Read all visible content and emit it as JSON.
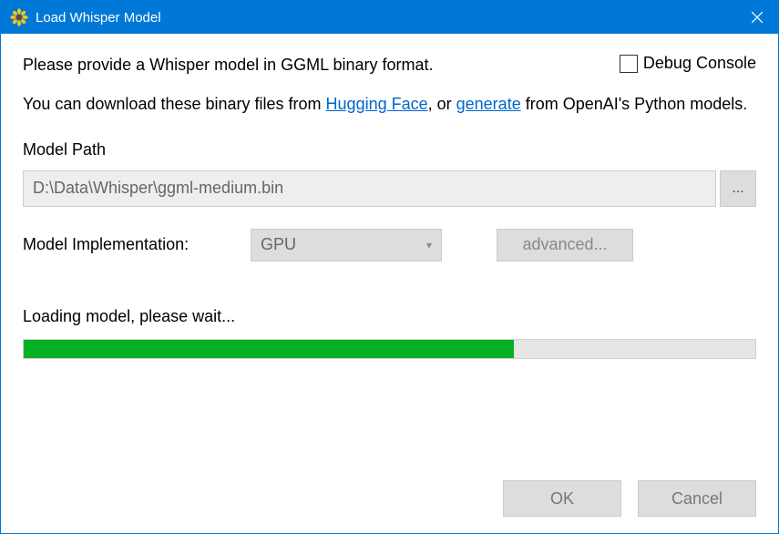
{
  "titlebar": {
    "title": "Load Whisper Model"
  },
  "intro": "Please provide a Whisper model in GGML binary format.",
  "debug_label": "Debug Console",
  "download": {
    "prefix": "You can download these binary files from ",
    "link1": "Hugging Face",
    "mid": ", or ",
    "link2": "generate",
    "suffix": " from OpenAI's Python models."
  },
  "model_path_label": "Model Path",
  "model_path_value": "D:\\Data\\Whisper\\ggml-medium.bin",
  "browse_label": "...",
  "impl_label": "Model Implementation:",
  "impl_value": "GPU",
  "advanced_label": "advanced...",
  "status_text": "Loading model, please wait...",
  "progress_percent": 67,
  "ok_label": "OK",
  "cancel_label": "Cancel"
}
